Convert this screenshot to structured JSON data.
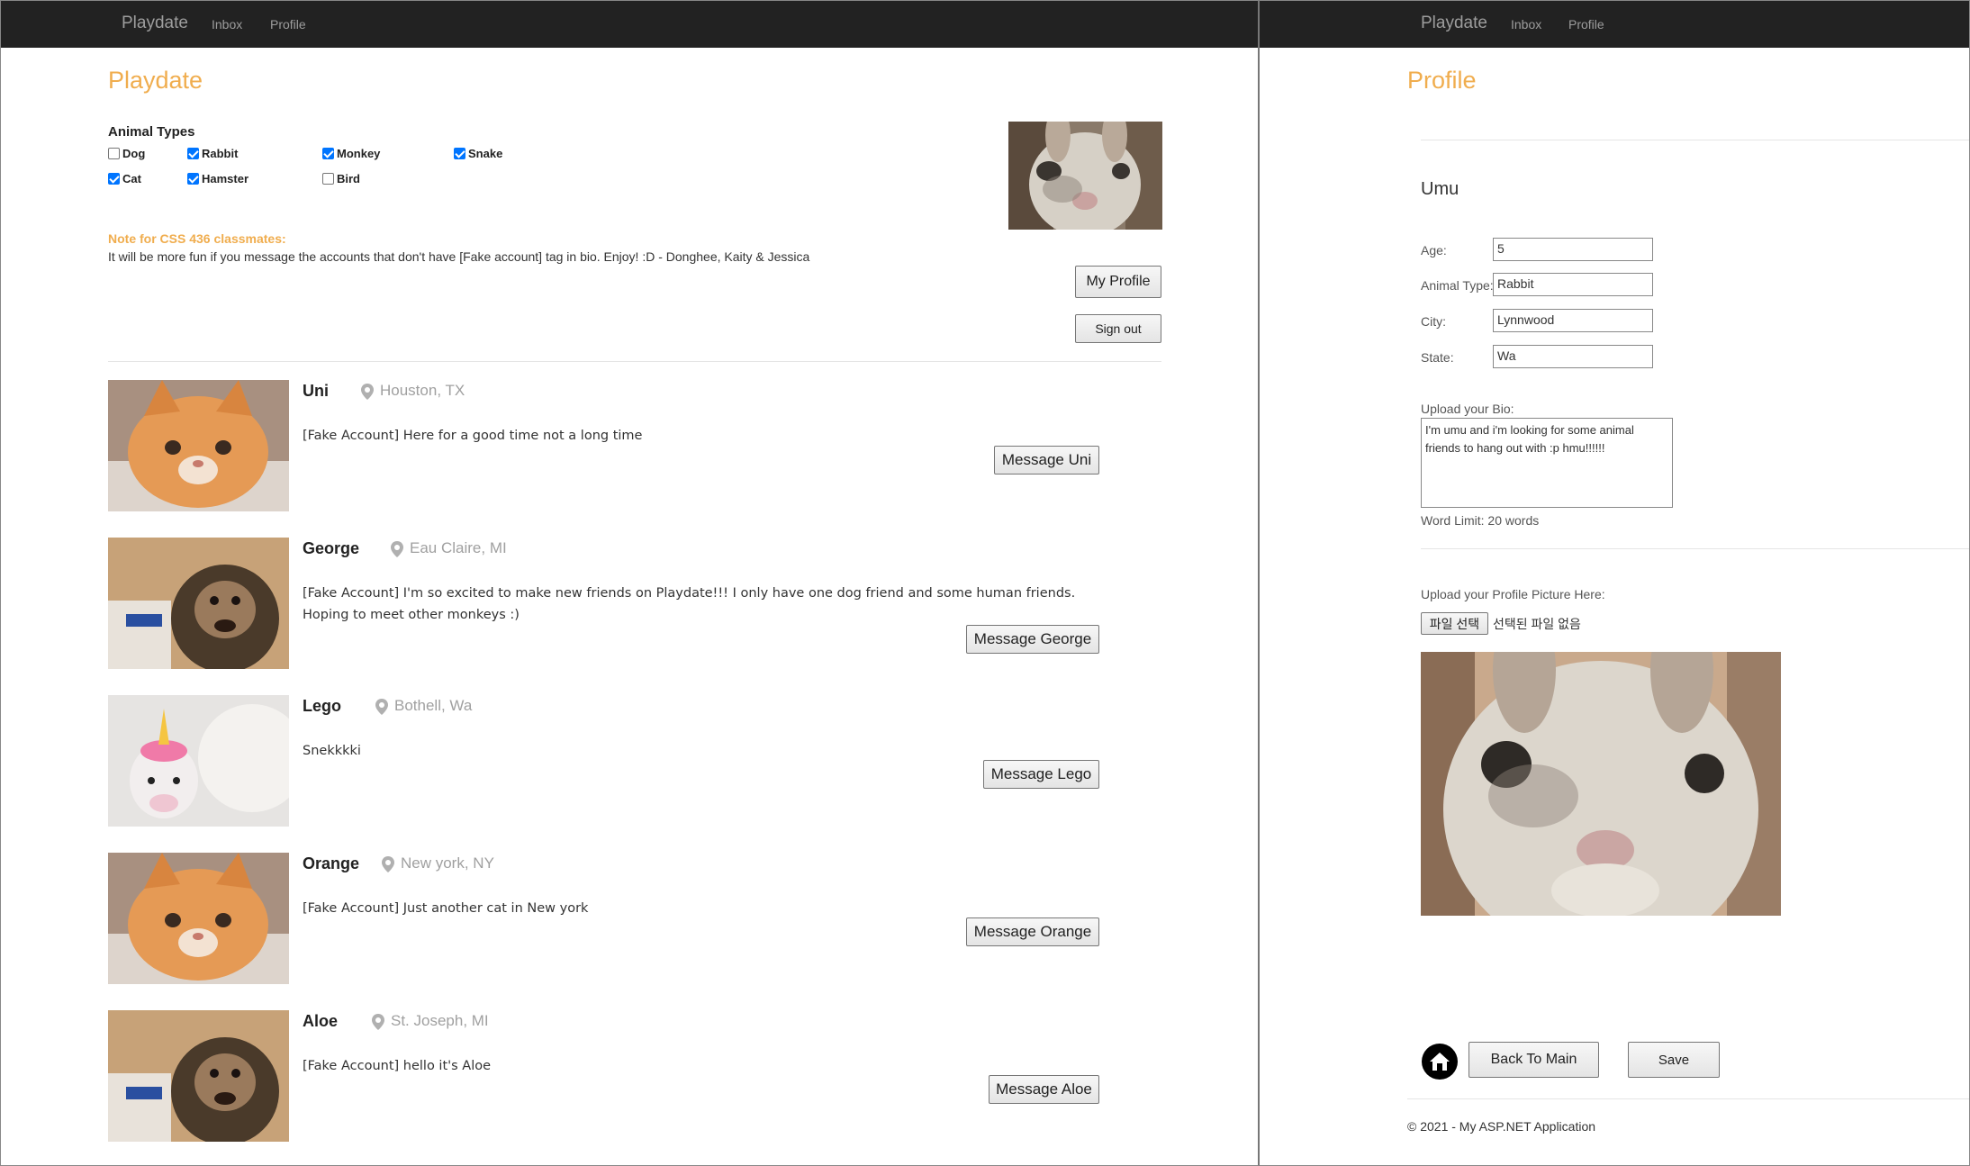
{
  "left": {
    "nav": {
      "brand": "Playdate",
      "links": [
        "Inbox",
        "Profile"
      ]
    },
    "title": "Playdate",
    "filters": {
      "title": "Animal Types",
      "items": [
        {
          "label": "Dog",
          "checked": false
        },
        {
          "label": "Rabbit",
          "checked": true
        },
        {
          "label": "Monkey",
          "checked": true
        },
        {
          "label": "Snake",
          "checked": true
        },
        {
          "label": "Cat",
          "checked": true
        },
        {
          "label": "Hamster",
          "checked": true
        },
        {
          "label": "Bird",
          "checked": false
        }
      ]
    },
    "note": {
      "title": "Note for CSS 436 classmates:",
      "text": "It will be more fun if you message the accounts that don't have [Fake account] tag in bio. Enjoy! :D - Donghee, Kaity & Jessica"
    },
    "buttons": {
      "my_profile": "My Profile",
      "sign_out": "Sign out"
    },
    "feed": [
      {
        "name": "Uni",
        "location": "Houston, TX",
        "bio": "[Fake Account] Here for a good time not a long time",
        "button": "Message Uni",
        "photo": "cat-photo"
      },
      {
        "name": "George",
        "location": "Eau Claire, MI",
        "bio": "[Fake Account] I'm so excited to make new friends on Playdate!!! I only have one dog friend and some human friends. Hoping to meet other monkeys :)",
        "button": "Message George",
        "photo": "monkey-photo"
      },
      {
        "name": "Lego",
        "location": "Bothell, Wa",
        "bio": "Snekkkki",
        "button": "Message Lego",
        "photo": "snake-photo"
      },
      {
        "name": "Orange",
        "location": "New york, NY",
        "bio": "[Fake Account] Just another cat in New york",
        "button": "Message Orange",
        "photo": "cat-photo"
      },
      {
        "name": "Aloe",
        "location": "St. Joseph, MI",
        "bio": "[Fake Account] hello it's Aloe",
        "button": "Message Aloe",
        "photo": "monkey-photo"
      }
    ]
  },
  "right": {
    "nav": {
      "brand": "Playdate",
      "links": [
        "Inbox",
        "Profile"
      ]
    },
    "title": "Profile",
    "username": "Umu",
    "fields": {
      "age_label": "Age:",
      "age": "5",
      "type_label": "Animal Type:",
      "type": "Rabbit",
      "city_label": "City:",
      "city": "Lynnwood",
      "state_label": "State:",
      "state": "Wa"
    },
    "bio": {
      "label": "Upload your Bio:",
      "text": "I'm umu and i'm looking for some animal friends to hang out with :p hmu!!!!!!",
      "limit": "Word Limit: 20 words"
    },
    "upload": {
      "label": "Upload your Profile Picture Here:",
      "button": "파일 선택",
      "status": "선택된 파일 없음"
    },
    "buttons": {
      "back": "Back To Main",
      "save": "Save"
    },
    "footer": "© 2021 - My ASP.NET Application"
  }
}
